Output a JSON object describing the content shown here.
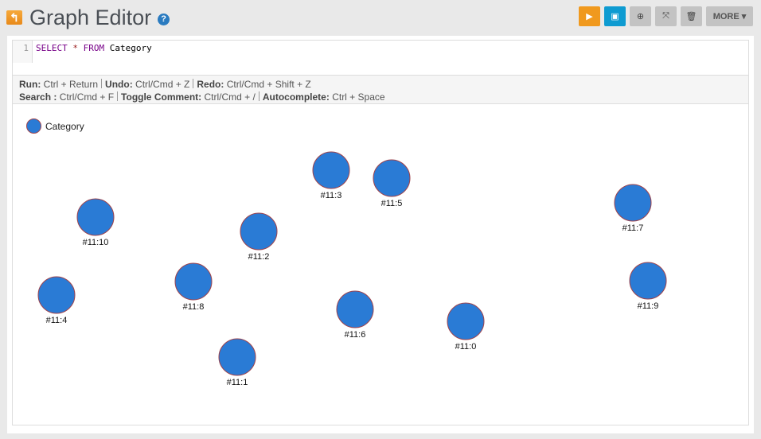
{
  "header": {
    "title": "Graph Editor",
    "back_icon": "back-arrow-icon",
    "help_icon": "question-icon"
  },
  "toolbar": {
    "run_icon": "play-icon",
    "save_icon": "floppy-icon",
    "add_icon": "plus-circle-icon",
    "fullscreen_icon": "expand-icon",
    "delete_icon": "trash-icon",
    "more_label": "MORE"
  },
  "colors": {
    "run": "#f0991e",
    "save": "#0e9bd1",
    "node_fill": "#2a7bd5",
    "node_stroke": "#a0434b"
  },
  "editor": {
    "line_number": "1",
    "kw1": "SELECT",
    "star": "*",
    "kw2": "FROM",
    "ident": "Category"
  },
  "shortcuts": [
    {
      "k": "Run:",
      "v": "Ctrl + Return"
    },
    {
      "k": "Undo:",
      "v": "Ctrl/Cmd + Z"
    },
    {
      "k": "Redo:",
      "v": "Ctrl/Cmd + Shift + Z"
    },
    {
      "k": "Search :",
      "v": "Ctrl/Cmd + F"
    },
    {
      "k": "Toggle Comment:",
      "v": "Ctrl/Cmd + /"
    },
    {
      "k": "Autocomplete:",
      "v": "Ctrl + Space"
    }
  ],
  "legend": {
    "label": "Category"
  },
  "nodes": [
    "#11:3",
    "#11:5",
    "#11:10",
    "#11:2",
    "#11:7",
    "#11:8",
    "#11:4",
    "#11:9",
    "#11:6",
    "#11:0",
    "#11:1"
  ]
}
